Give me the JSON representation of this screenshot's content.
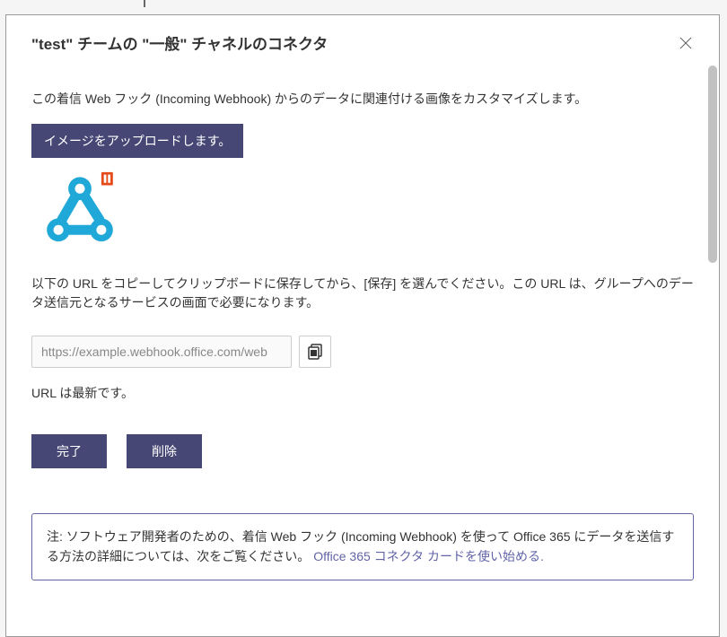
{
  "header": {
    "title": "\"test\" チームの \"一般\" チャネルのコネクタ"
  },
  "description": "この着信 Web フック (Incoming Webhook) からのデータに関連付ける画像をカスタマイズします。",
  "upload_button": "イメージをアップロードします。",
  "url_description": "以下の URL をコピーしてクリップボードに保存してから、[保存] を選んでください。この URL は、グループへのデータ送信元となるサービスの画面で必要になります。",
  "url_value": "https://example.webhook.office.com/web",
  "url_status": "URL は最新です。",
  "buttons": {
    "done": "完了",
    "delete": "削除"
  },
  "note": {
    "text": "注: ソフトウェア開発者のための、着信 Web フック (Incoming Webhook) を使って Office 365 にデータを送信する方法の詳細については、次をご覧ください。",
    "link_text": "Office 365 コネクタ カードを使い始める."
  }
}
